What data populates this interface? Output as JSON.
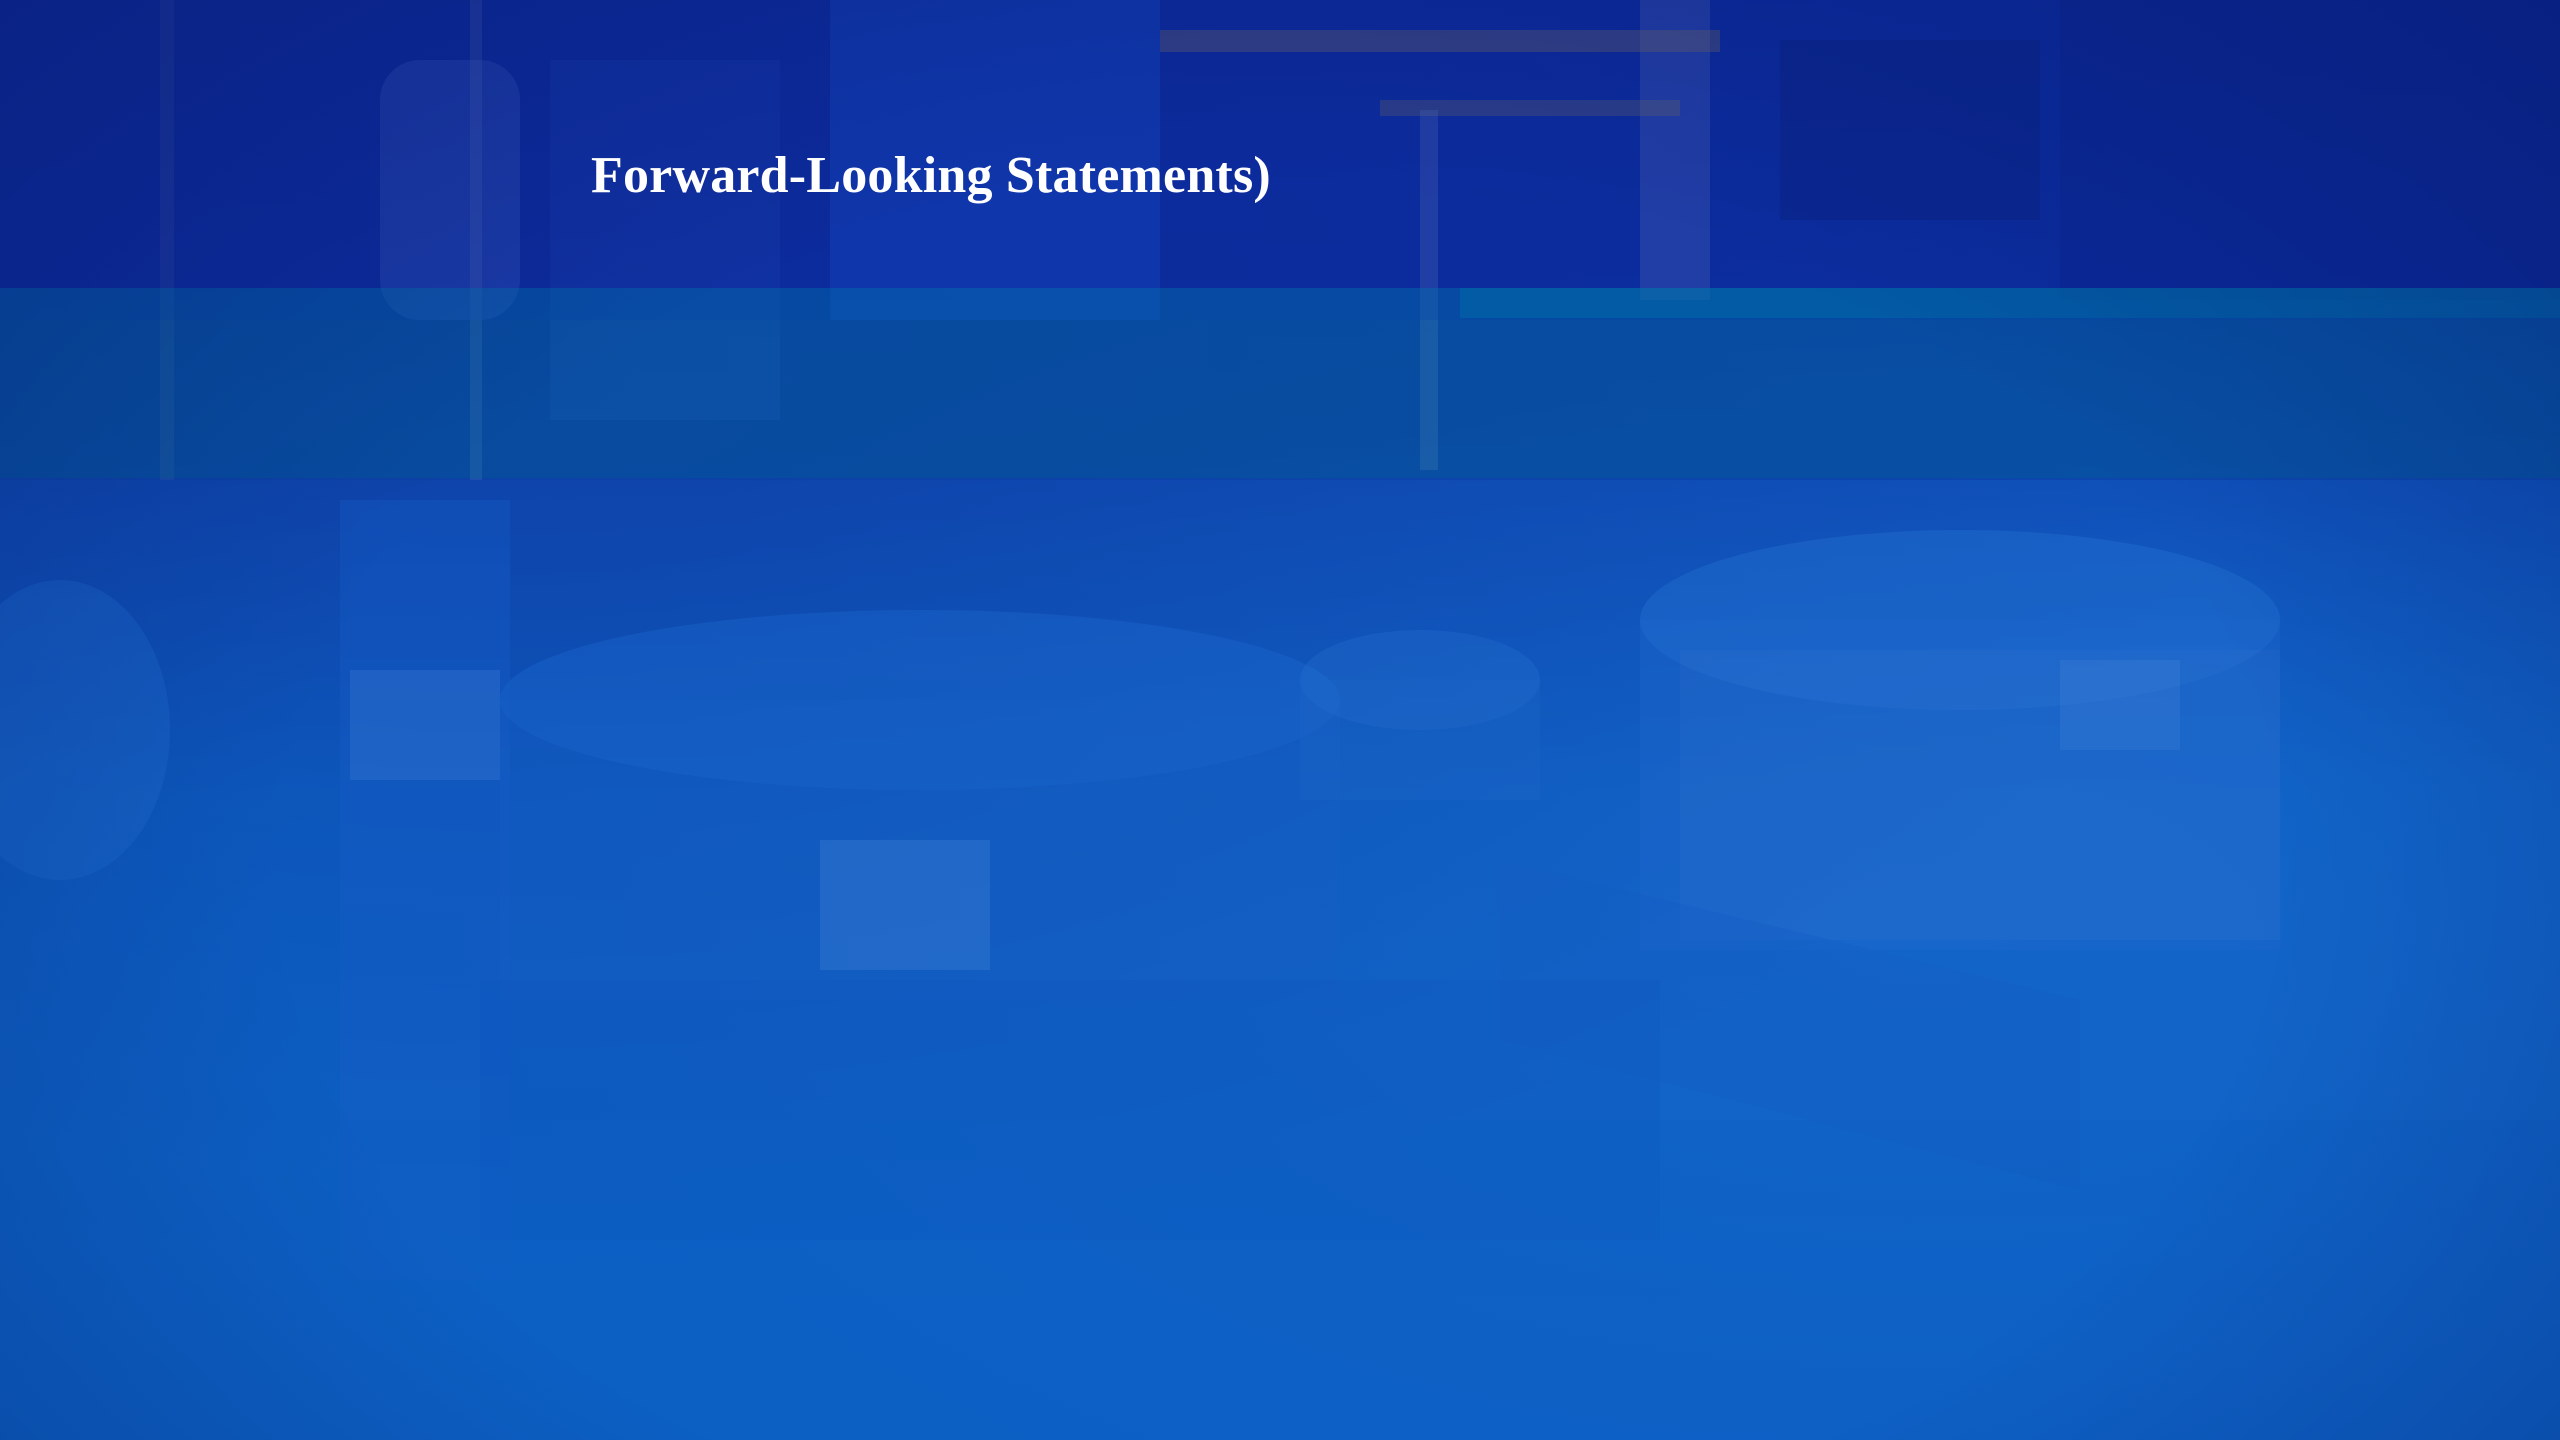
{
  "slide": {
    "title": "Forward-Looking Statements)"
  },
  "background": {
    "image": "industrial-reactor-tanks-photo",
    "tint": "#0b3fa8",
    "accent_band": "#0a6fb0"
  }
}
